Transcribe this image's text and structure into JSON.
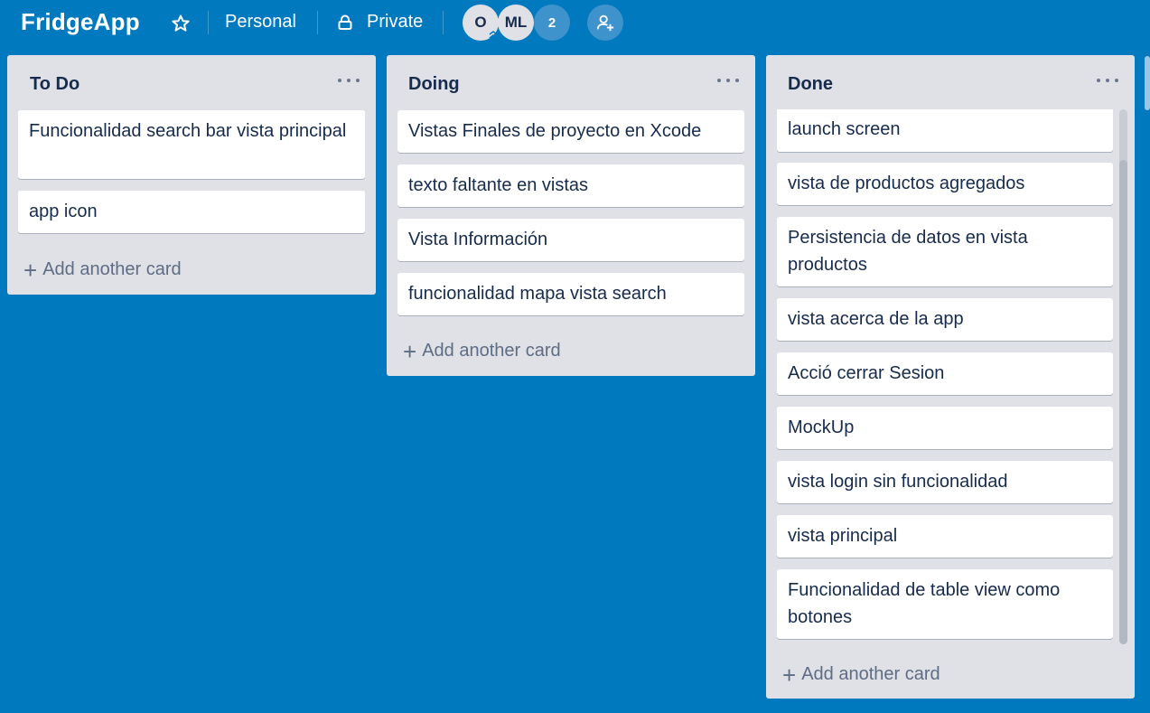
{
  "board": {
    "title": "FridgeApp",
    "team": "Personal",
    "visibility": "Private",
    "members": [
      {
        "initials": "O"
      },
      {
        "initials": "ML"
      }
    ],
    "extra_members_count": "2",
    "icons": {
      "star": "star-icon",
      "lock": "lock-icon",
      "invite": "add-member-icon"
    }
  },
  "lists": [
    {
      "title": "To Do",
      "cards": [
        "Funcionalidad search bar vista principal",
        "app icon"
      ],
      "add_label": "Add another card"
    },
    {
      "title": "Doing",
      "cards": [
        "Vistas Finales de proyecto en Xcode",
        "texto faltante en vistas",
        "Vista Información",
        "funcionalidad mapa vista search"
      ],
      "add_label": "Add another card"
    },
    {
      "title": "Done",
      "cards": [
        "launch screen",
        "vista de productos agregados",
        "Persistencia de datos en vista productos",
        "vista acerca de la app",
        "Acció cerrar Sesion",
        "MockUp",
        "vista login sin funcionalidad",
        "vista principal",
        "Funcionalidad de table view como botones"
      ],
      "add_label": "Add another card"
    }
  ],
  "colors": {
    "board_bg": "#0079bf",
    "list_bg": "#dfe1e6",
    "card_bg": "#ffffff",
    "text": "#172b4d",
    "muted": "#5e6c84"
  }
}
